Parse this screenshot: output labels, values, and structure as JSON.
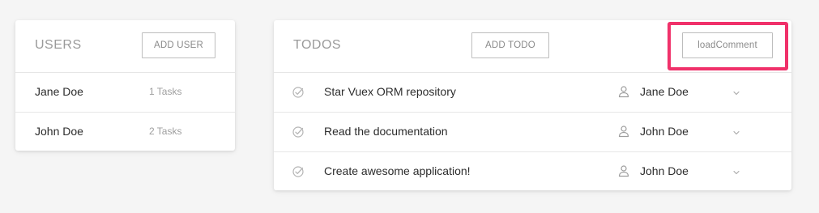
{
  "users_panel": {
    "title": "USERS",
    "add_label": "ADD USER",
    "users": [
      {
        "name": "Jane Doe",
        "tasks": "1 Tasks"
      },
      {
        "name": "John Doe",
        "tasks": "2 Tasks"
      }
    ]
  },
  "todos_panel": {
    "title": "TODOS",
    "add_label": "ADD TODO",
    "load_comment_label": "loadComment",
    "todos": [
      {
        "title": "Star Vuex ORM repository",
        "user": "Jane Doe"
      },
      {
        "title": "Read the documentation",
        "user": "John Doe"
      },
      {
        "title": "Create awesome application!",
        "user": "John Doe"
      }
    ]
  },
  "colors": {
    "highlight": "#f0316a",
    "background": "#f5f5f5"
  },
  "icons": {
    "todo_status": "check-circle-icon",
    "assignee": "user-icon",
    "dropdown": "chevron-down-icon"
  }
}
